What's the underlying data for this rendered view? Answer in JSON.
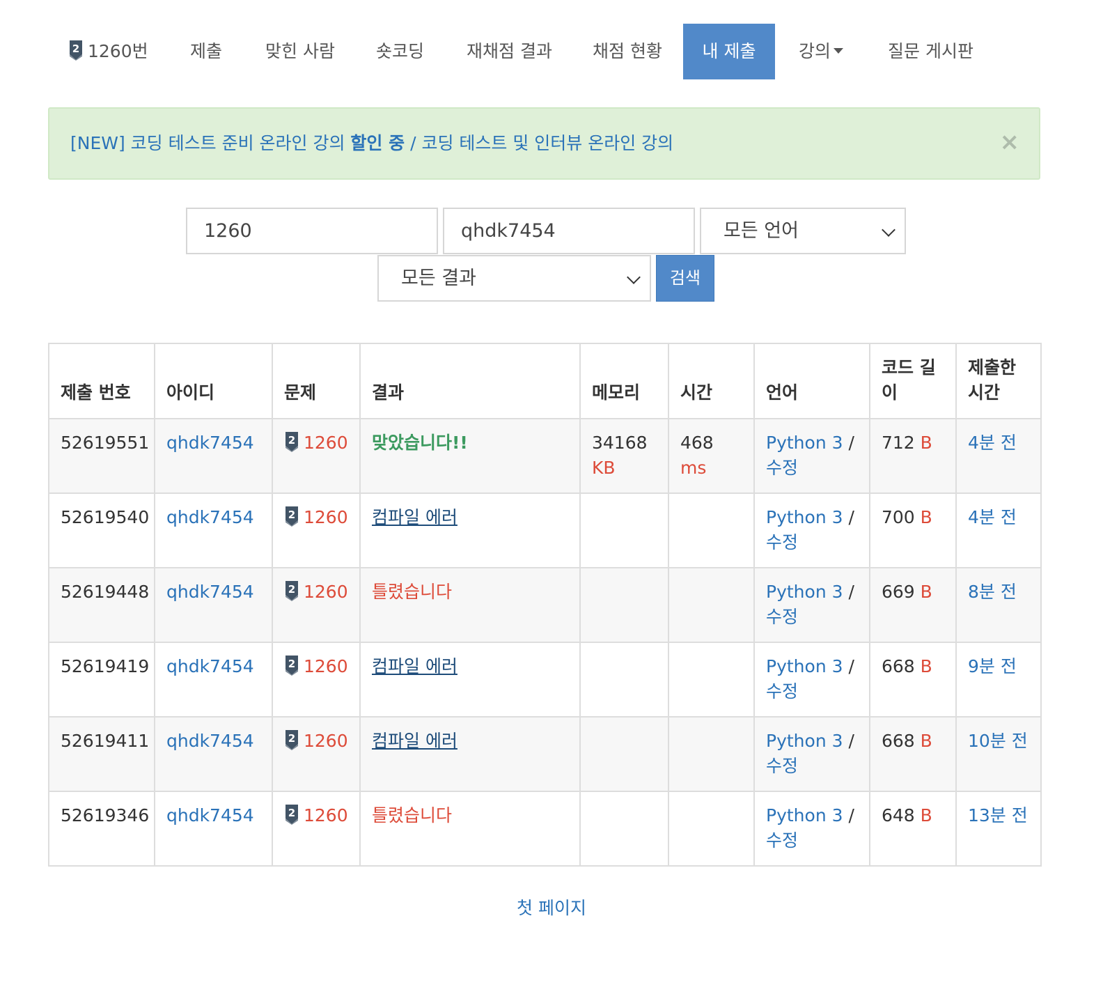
{
  "nav": {
    "problem_tier": "2",
    "problem_label": "1260번",
    "items": [
      "제출",
      "맞힌 사람",
      "숏코딩",
      "재채점 결과",
      "채점 현황",
      "내 제출",
      "강의",
      "질문 게시판"
    ]
  },
  "alert": {
    "part1": "[NEW] 코딩 테스트 준비 온라인 강의 ",
    "part2": "할인 중",
    "part3": " / 코딩 테스트 및 인터뷰 온라인 강의",
    "close": "×"
  },
  "search": {
    "problem_value": "1260",
    "user_value": "qhdk7454",
    "language_selected": "모든 언어",
    "result_selected": "모든 결과",
    "button_label": "검색"
  },
  "table": {
    "headers": [
      "제출 번호",
      "아이디",
      "문제",
      "결과",
      "메모리",
      "시간",
      "언어",
      "코드 길이",
      "제출한 시간"
    ],
    "rows": [
      {
        "id": "52619551",
        "user": "qhdk7454",
        "tier": "2",
        "problem": "1260",
        "result": "맞았습니다!!",
        "result_type": "ok",
        "memory": "34168",
        "memory_unit": "KB",
        "time": "468",
        "time_unit": "ms",
        "lang": "Python 3",
        "edit": "수정",
        "code_len": "712",
        "code_unit": "B",
        "submitted": "4분 전"
      },
      {
        "id": "52619540",
        "user": "qhdk7454",
        "tier": "2",
        "problem": "1260",
        "result": "컴파일 에러",
        "result_type": "ce",
        "memory": "",
        "memory_unit": "",
        "time": "",
        "time_unit": "",
        "lang": "Python 3",
        "edit": "수정",
        "code_len": "700",
        "code_unit": "B",
        "submitted": "4분 전"
      },
      {
        "id": "52619448",
        "user": "qhdk7454",
        "tier": "2",
        "problem": "1260",
        "result": "틀렸습니다",
        "result_type": "wa",
        "memory": "",
        "memory_unit": "",
        "time": "",
        "time_unit": "",
        "lang": "Python 3",
        "edit": "수정",
        "code_len": "669",
        "code_unit": "B",
        "submitted": "8분 전"
      },
      {
        "id": "52619419",
        "user": "qhdk7454",
        "tier": "2",
        "problem": "1260",
        "result": "컴파일 에러",
        "result_type": "ce",
        "memory": "",
        "memory_unit": "",
        "time": "",
        "time_unit": "",
        "lang": "Python 3",
        "edit": "수정",
        "code_len": "668",
        "code_unit": "B",
        "submitted": "9분 전"
      },
      {
        "id": "52619411",
        "user": "qhdk7454",
        "tier": "2",
        "problem": "1260",
        "result": "컴파일 에러",
        "result_type": "ce",
        "memory": "",
        "memory_unit": "",
        "time": "",
        "time_unit": "",
        "lang": "Python 3",
        "edit": "수정",
        "code_len": "668",
        "code_unit": "B",
        "submitted": "10분 전"
      },
      {
        "id": "52619346",
        "user": "qhdk7454",
        "tier": "2",
        "problem": "1260",
        "result": "틀렸습니다",
        "result_type": "wa",
        "memory": "",
        "memory_unit": "",
        "time": "",
        "time_unit": "",
        "lang": "Python 3",
        "edit": "수정",
        "code_len": "648",
        "code_unit": "B",
        "submitted": "13분 전"
      }
    ]
  },
  "pagination": {
    "first_page": "첫 페이지"
  }
}
